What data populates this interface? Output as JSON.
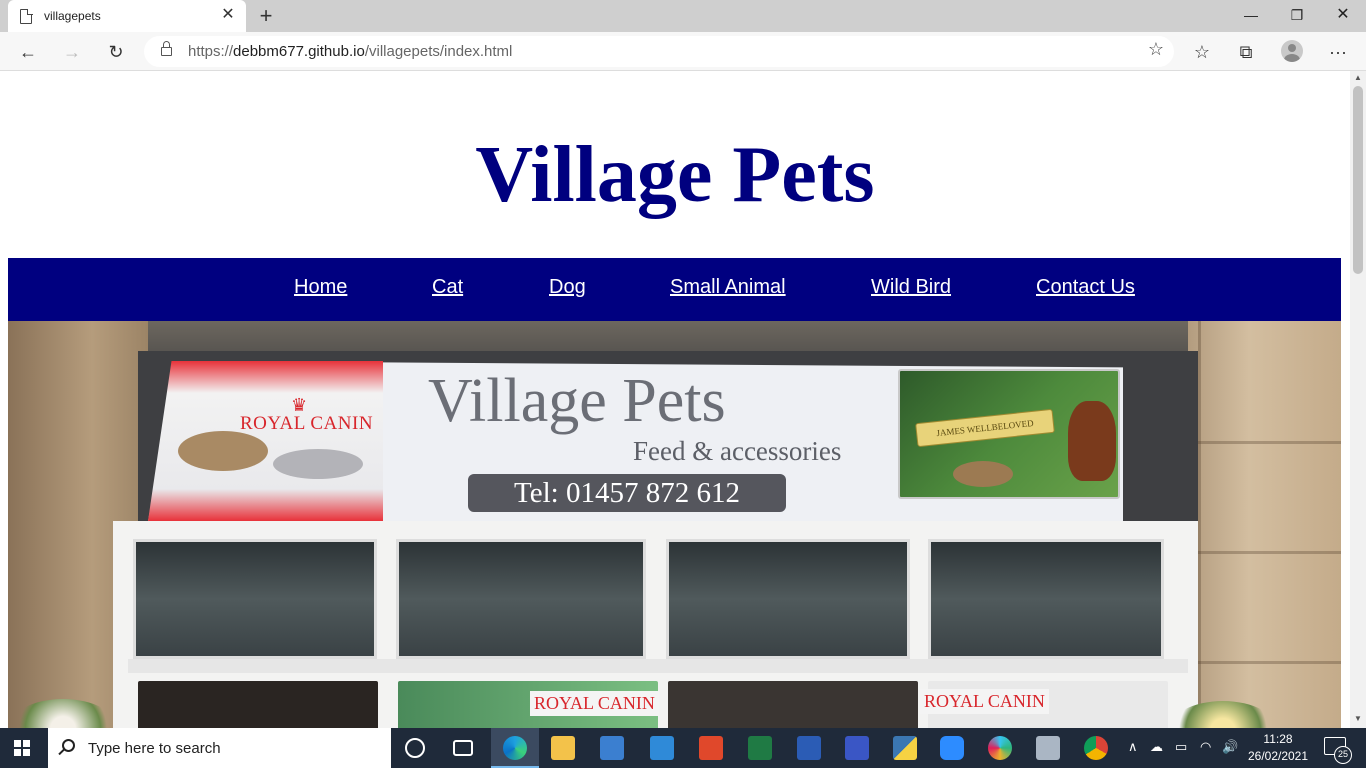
{
  "browser": {
    "tab_title": "villagepets",
    "tab_close": "✕",
    "new_tab": "+",
    "minimize": "—",
    "restore": "❐",
    "close": "✕",
    "back": "←",
    "forward": "→",
    "refresh": "↻",
    "url_prefix": "https://",
    "url_host": "debbm677.github.io",
    "url_path": "/villagepets/index.html",
    "add_favorite": "☆",
    "favorites": "☆",
    "collections": "⧉",
    "more": "···"
  },
  "page": {
    "site_title": "Village Pets",
    "nav": [
      {
        "label": "Home"
      },
      {
        "label": "Cat"
      },
      {
        "label": "Dog"
      },
      {
        "label": "Small Animal"
      },
      {
        "label": "Wild Bird"
      },
      {
        "label": "Contact Us"
      }
    ],
    "hero": {
      "brand_left": "ROYAL CANIN",
      "sign_title": "Village Pets",
      "sign_subtitle": "Feed & accessories",
      "sign_tel": "Tel:  01457 872 612",
      "ribbon": "JAMES WELLBELOVED",
      "lower_brand_1": "ROYAL CANIN",
      "lower_brand_2": "ROYAL CANIN"
    }
  },
  "taskbar": {
    "search_placeholder": "Type here to search",
    "time": "11:28",
    "date": "26/02/2021",
    "notifications_count": "25",
    "tray_chevron": "∧",
    "volume": "🔊"
  },
  "colors": {
    "title": "#00007f",
    "nav_bg": "#000080",
    "nav_text": "#ffffff",
    "taskbar": "#1f2a3a"
  }
}
